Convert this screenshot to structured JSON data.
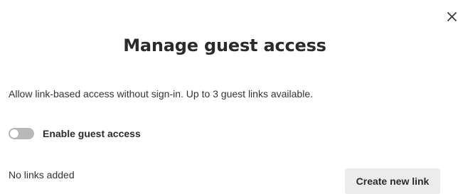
{
  "dialog": {
    "title": "Manage guest access",
    "description": "Allow link-based access without sign-in. Up to 3 guest links available.",
    "close_icon": "close-icon",
    "guest_access_toggle": {
      "label": "Enable guest access",
      "enabled": false,
      "track_color": "#b9b9b9"
    },
    "links_status": "No links added",
    "create_link_label": "Create new link"
  }
}
